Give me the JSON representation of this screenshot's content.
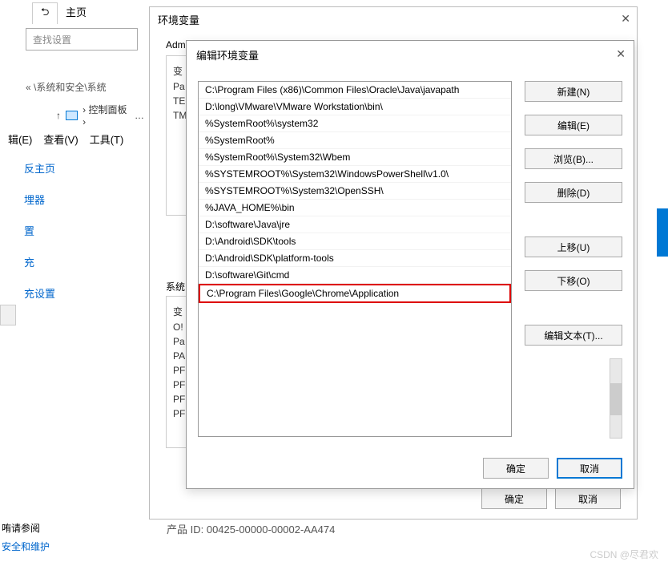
{
  "top_tabs": {
    "back_icon": "⮌",
    "home": "主页"
  },
  "search_placeholder": "查找设置",
  "breadcrumb": "« \\系统和安全\\系统",
  "nav": {
    "up": "↑",
    "panel": "› 控制面板 ›",
    "dots": "…"
  },
  "menu": {
    "edit": "辑(E)",
    "view": "查看(V)",
    "tools": "工具(T)"
  },
  "side_links": [
    "反主页",
    "埋器",
    "置",
    "充",
    "充设置"
  ],
  "footer": {
    "see_also": "哊请参阅",
    "security_maint": "安全和维护"
  },
  "product_id": "产品 ID: 00425-00000-00002-AA474",
  "dialog1": {
    "title": "环境变量",
    "group1_label": "Adm",
    "vars1": [
      "变",
      "Pa",
      "TE",
      "TM"
    ],
    "group2_label": "系统",
    "vars2": [
      "变",
      "O!",
      "Pa",
      "PA",
      "PF",
      "PF",
      "PF",
      "PF"
    ],
    "ok": "确定",
    "cancel": "取消"
  },
  "dialog2": {
    "title": "编辑环境变量",
    "paths": [
      "C:\\Program Files (x86)\\Common Files\\Oracle\\Java\\javapath",
      "D:\\long\\VMware\\VMware Workstation\\bin\\",
      "%SystemRoot%\\system32",
      "%SystemRoot%",
      "%SystemRoot%\\System32\\Wbem",
      "%SYSTEMROOT%\\System32\\WindowsPowerShell\\v1.0\\",
      "%SYSTEMROOT%\\System32\\OpenSSH\\",
      "%JAVA_HOME%\\bin",
      "D:\\software\\Java\\jre",
      "D:\\Android\\SDK\\tools",
      "D:\\Android\\SDK\\platform-tools",
      "D:\\software\\Git\\cmd",
      "C:\\Program Files\\Google\\Chrome\\Application"
    ],
    "highlighted_index": 12,
    "buttons": {
      "new": "新建(N)",
      "edit": "编辑(E)",
      "browse": "浏览(B)...",
      "delete": "删除(D)",
      "move_up": "上移(U)",
      "move_down": "下移(O)",
      "edit_text": "编辑文本(T)..."
    },
    "ok": "确定",
    "cancel": "取消"
  },
  "watermark": "CSDN @尽君欢"
}
